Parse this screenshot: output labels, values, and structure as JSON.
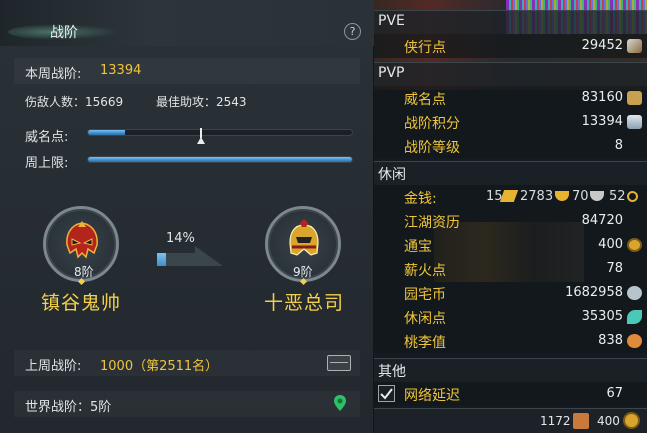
{
  "left": {
    "title": "战阶",
    "help": "?",
    "week_rank_label": "本周战阶:",
    "week_rank_value": "13394",
    "kills_text": "伤敌人数：15669",
    "assist_text": "最佳助攻：2543",
    "fame_label": "威名点:",
    "fame_progress": 0.14,
    "fame_marker": 0.43,
    "week_cap_label": "周上限:",
    "week_cap_progress": 1.0,
    "progress_percent": "14%",
    "current_rank": {
      "level": "8阶",
      "name": "镇谷鬼帅"
    },
    "next_rank": {
      "level": "9阶",
      "name": "十恶总司"
    },
    "last_week_label": "上周战阶:",
    "last_week_value": "1000（第2511名）",
    "world_rank_text": "世界战阶：5阶"
  },
  "right": {
    "pve_header": "PVE",
    "pve_rows": [
      {
        "label": "侠行点",
        "value": "29452",
        "icon": "sword-icon"
      }
    ],
    "pvp_header": "PVP",
    "pvp_rows": [
      {
        "label": "威名点",
        "value": "83160",
        "icon": "fame-token-icon"
      },
      {
        "label": "战阶积分",
        "value": "13394",
        "icon": "crest-icon"
      },
      {
        "label": "战阶等级",
        "value": "8",
        "icon": ""
      }
    ],
    "leisure_header": "休闲",
    "money": {
      "label": "金钱:",
      "gold_bars": "15",
      "ingots": "2783",
      "silver": "70",
      "coins": "52"
    },
    "leisure_rows": [
      {
        "label": "江湖资历",
        "value": "84720",
        "icon": ""
      },
      {
        "label": "通宝",
        "value": "400",
        "icon": "coin-icon"
      },
      {
        "label": "薪火点",
        "value": "78",
        "icon": ""
      },
      {
        "label": "园宅币",
        "value": "1682958",
        "icon": "house-coin-icon"
      },
      {
        "label": "休闲点",
        "value": "35305",
        "icon": "leaf-icon"
      },
      {
        "label": "桃李值",
        "value": "838",
        "icon": "peach-icon"
      }
    ],
    "other_header": "其他",
    "other_rows": [
      {
        "label": "网络延迟",
        "value": "67",
        "checked": true
      }
    ],
    "bottom": {
      "a": "1172",
      "b": "400"
    },
    "colors": {
      "accent_gold": "#f0c53a",
      "bar_blue": "#3d8ecb"
    }
  }
}
